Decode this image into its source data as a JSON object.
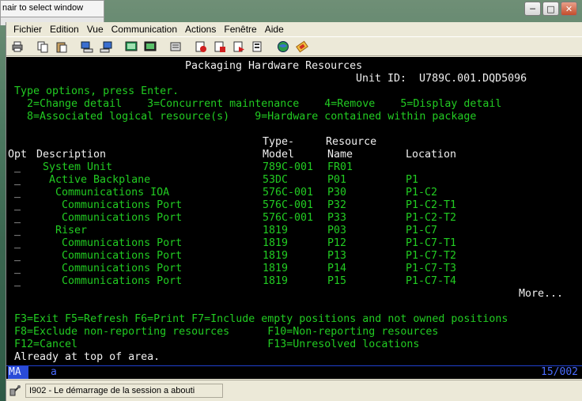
{
  "bg_window": {
    "text": "nair to select window"
  },
  "menu": [
    {
      "label": "Fichier"
    },
    {
      "label": "Edition"
    },
    {
      "label": "Vue"
    },
    {
      "label": "Communication"
    },
    {
      "label": "Actions"
    },
    {
      "label": "Fenêtre"
    },
    {
      "label": "Aide"
    }
  ],
  "toolbar_icons": [
    "print-icon",
    "copy-icon",
    "paste-icon",
    "send-icon",
    "receive-icon",
    "display-icon",
    "keypad-icon",
    "macro-icon",
    "record-icon",
    "stop-icon",
    "play-icon",
    "macro-run-icon",
    "globe-icon",
    "edit-icon"
  ],
  "screen": {
    "title": "Packaging Hardware Resources",
    "unit_id": "Unit ID:  U789C.001.DQD5096",
    "instruction": "Type options, press Enter.",
    "options_line1": "2=Change detail    3=Concurrent maintenance    4=Remove    5=Display detail",
    "options_line2": "8=Associated logical resource(s)    9=Hardware contained within package",
    "header_top": "Type-     Resource",
    "header_opt": "Opt",
    "header_desc": "Description",
    "header_model": "Model",
    "header_name": "Name",
    "header_loc": "Location",
    "rows": [
      {
        "opt": "_",
        "desc": " System Unit",
        "model": "789C-001",
        "name": "FR01",
        "loc": ""
      },
      {
        "opt": "_",
        "desc": "  Active Backplane",
        "model": "53DC",
        "name": "P01",
        "loc": "P1"
      },
      {
        "opt": "_",
        "desc": "   Communications IOA",
        "model": "576C-001",
        "name": "P30",
        "loc": "P1-C2"
      },
      {
        "opt": "_",
        "desc": "    Communications Port",
        "model": "576C-001",
        "name": "P32",
        "loc": "P1-C2-T1"
      },
      {
        "opt": "_",
        "desc": "    Communications Port",
        "model": "576C-001",
        "name": "P33",
        "loc": "P1-C2-T2"
      },
      {
        "opt": "_",
        "desc": "   Riser",
        "model": "1819",
        "name": "P03",
        "loc": "P1-C7"
      },
      {
        "opt": "_",
        "desc": "    Communications Port",
        "model": "1819",
        "name": "P12",
        "loc": "P1-C7-T1"
      },
      {
        "opt": "_",
        "desc": "    Communications Port",
        "model": "1819",
        "name": "P13",
        "loc": "P1-C7-T2"
      },
      {
        "opt": "_",
        "desc": "    Communications Port",
        "model": "1819",
        "name": "P14",
        "loc": "P1-C7-T3"
      },
      {
        "opt": "_",
        "desc": "    Communications Port",
        "model": "1819",
        "name": "P15",
        "loc": "P1-C7-T4"
      }
    ],
    "more": "More...",
    "fkeys_line1": "F3=Exit F5=Refresh F6=Print F7=Include empty positions and not owned positions",
    "fkeys_line2": "F8=Exclude non-reporting resources      F10=Non-reporting resources",
    "fkeys_line3": "F12=Cancel                              F13=Unresolved locations",
    "message": "Already at top of area."
  },
  "oia": {
    "mode": "MA",
    "indicator": "a",
    "position": "15/002"
  },
  "status": {
    "text": "I902 - Le démarrage de la session a abouti"
  }
}
